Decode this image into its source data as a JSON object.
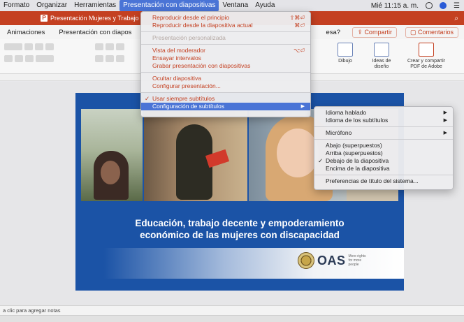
{
  "menubar": {
    "items": [
      {
        "label": "Formato",
        "active": false
      },
      {
        "label": "Organizar",
        "active": false
      },
      {
        "label": "Herramientas",
        "active": false
      },
      {
        "label": "Presentación con diapositivas",
        "active": true
      },
      {
        "label": "Ventana",
        "active": false
      },
      {
        "label": "Ayuda",
        "active": false
      }
    ],
    "clock": "Mié 11:15 a. m.",
    "search_icon": "search-icon",
    "siri_icon": "siri-icon",
    "list_icon": "list-icon"
  },
  "titlebar": {
    "app_badge": "P",
    "doc_title": "Presentación Mujeres y Trabajo",
    "search_icon": "search-icon"
  },
  "ribbon_tabs": {
    "tabs": [
      "Animaciones",
      "Presentación con diapos"
    ],
    "question": "esa?",
    "share_label": "Compartir",
    "comments_label": "Comentarios"
  },
  "ribbon": {
    "draw_label": "Dibujo",
    "ideas_label": "Ideas de diseño",
    "adobe_label": "Crear y compartir PDF de Adobe"
  },
  "main_menu": {
    "items": [
      {
        "label": "Reproducir desde el principio",
        "shortcut": "⇧⌘⏎",
        "disabled": false
      },
      {
        "label": "Reproducir desde la diapositiva actual",
        "shortcut": "⌘⏎",
        "disabled": false
      },
      {
        "sep": true
      },
      {
        "label": "Presentación personalizada",
        "shortcut": "",
        "disabled": true
      },
      {
        "sep": true
      },
      {
        "label": "Vista del moderador",
        "shortcut": "⌥⏎",
        "disabled": false
      },
      {
        "label": "Ensayar intervalos",
        "shortcut": "",
        "disabled": false
      },
      {
        "label": "Grabar presentación con diapositivas",
        "shortcut": "",
        "disabled": false
      },
      {
        "sep": true
      },
      {
        "label": "Ocultar diapositiva",
        "shortcut": "",
        "disabled": false
      },
      {
        "label": "Configurar presentación...",
        "shortcut": "",
        "disabled": false
      },
      {
        "sep": true
      },
      {
        "label": "Usar siempre subtítulos",
        "shortcut": "",
        "checked": true
      },
      {
        "label": "Configuración de subtítulos",
        "shortcut": "",
        "highlighted": true,
        "submenu": true
      }
    ]
  },
  "sub_menu": {
    "items": [
      {
        "label": "Idioma hablado",
        "submenu": true
      },
      {
        "label": "Idioma de los subtítulos",
        "submenu": true
      },
      {
        "sep": true
      },
      {
        "label": "Micrófono",
        "submenu": true
      },
      {
        "sep": true
      },
      {
        "label": "Abajo (superpuestos)"
      },
      {
        "label": "Arriba (superpuestos)"
      },
      {
        "label": "Debajo de la diapositiva",
        "checked": true
      },
      {
        "label": "Encima de la diapositiva"
      },
      {
        "sep": true
      },
      {
        "label": "Preferencias de título del sistema..."
      }
    ]
  },
  "slide": {
    "title_line1": "Educación, trabajo decente y empoderamiento",
    "title_line2": "económico de las mujeres con discapacidad",
    "logo_text": "OAS",
    "logo_sub": "More rights for more people"
  },
  "notes": {
    "placeholder": "a clic para agregar notas"
  },
  "colors": {
    "brand": "#c44021",
    "menu_highlight": "#4a74d6",
    "slide_bg": "#1b53a6"
  }
}
